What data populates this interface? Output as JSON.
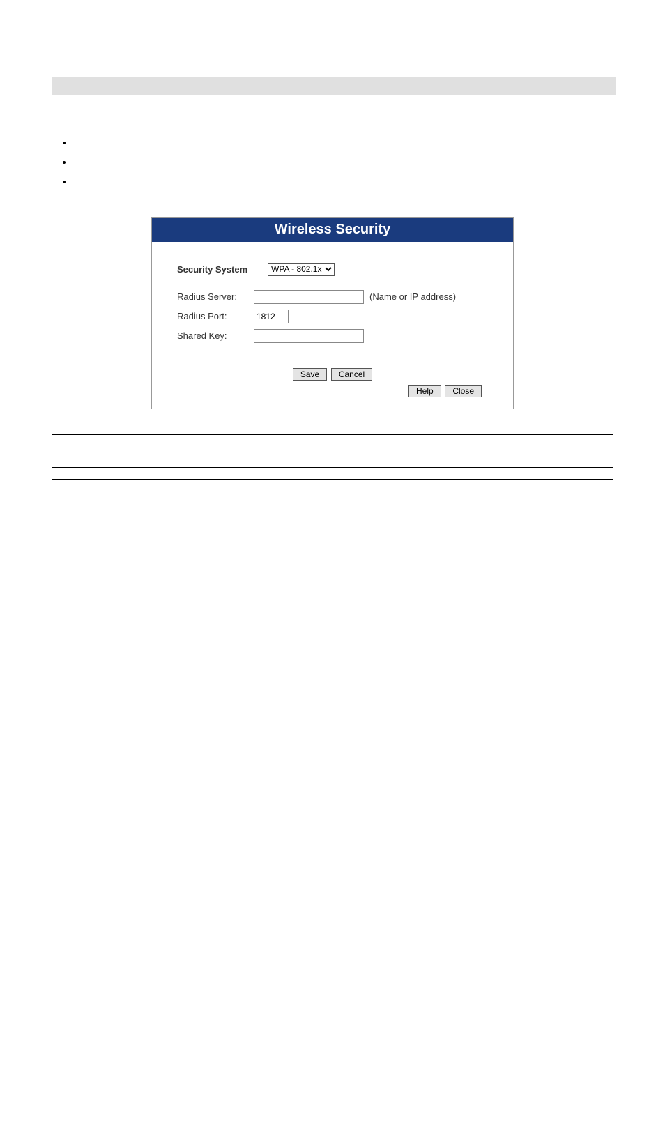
{
  "panel": {
    "title": "Wireless Security",
    "security_system_label": "Security System",
    "security_system_value": "WPA - 802.1x",
    "radius_server_label": "Radius Server:",
    "radius_server_value": "",
    "radius_server_hint": "(Name or IP address)",
    "radius_port_label": "Radius Port:",
    "radius_port_value": "1812",
    "shared_key_label": "Shared Key:",
    "shared_key_value": "",
    "buttons": {
      "save": "Save",
      "cancel": "Cancel",
      "help": "Help",
      "close": "Close"
    }
  },
  "bullets": [
    "",
    "",
    ""
  ],
  "defs_rows": [
    {
      "key": "",
      "val": ""
    },
    {
      "key": "",
      "val": ""
    },
    {
      "key": "",
      "val": ""
    }
  ]
}
